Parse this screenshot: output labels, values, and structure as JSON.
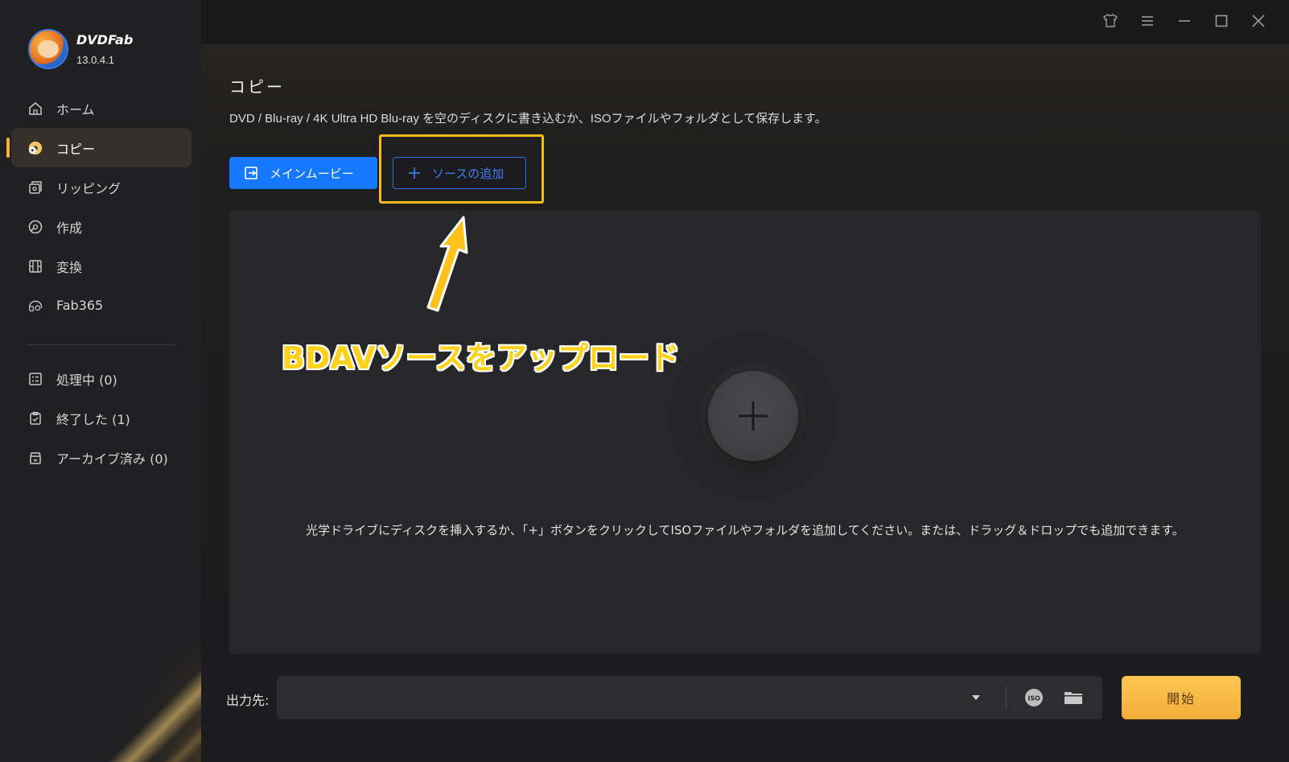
{
  "app": {
    "name": "DVDFab",
    "version": "13.0.4.1"
  },
  "sidebar": {
    "items": [
      {
        "label": "ホーム",
        "icon": "home-icon"
      },
      {
        "label": "コピー",
        "icon": "copy-disc-icon",
        "active": true
      },
      {
        "label": "リッピング",
        "icon": "ripper-icon"
      },
      {
        "label": "作成",
        "icon": "creator-icon"
      },
      {
        "label": "変換",
        "icon": "film-icon"
      },
      {
        "label": "Fab365",
        "icon": "fab365-icon"
      }
    ],
    "tasks": [
      {
        "label": "処理中 (0)",
        "icon": "processing-list-icon"
      },
      {
        "label": "終了した (1)",
        "icon": "finished-clipboard-icon"
      },
      {
        "label": "アーカイブ済み (0)",
        "icon": "archive-box-icon"
      }
    ]
  },
  "window": {
    "controls": [
      "skin-icon",
      "menu-icon",
      "minimize-icon",
      "maximize-icon",
      "close-icon"
    ]
  },
  "main": {
    "title": "コピー",
    "description": "DVD / Blu-ray / 4K Ultra HD Blu-ray を空のディスクに書き込むか、ISOファイルやフォルダとして保存します。",
    "mode_button": "メインムービー",
    "add_source_button": "ソースの追加",
    "drop_hint": "光学ドライブにディスクを挿入するか、「+」ボタンをクリックしてISOファイルやフォルダを追加してください。または、ドラッグ＆ドロップでも追加できます。",
    "annotation": "BDAVソースをアップロード"
  },
  "output": {
    "label": "出力先:",
    "value": "",
    "start_button": "開始"
  },
  "colors": {
    "accent_blue": "#1677ff",
    "highlight_yellow": "#f7bb19",
    "start_orange": "#f7b941",
    "active_bar": "#f3b23b"
  }
}
